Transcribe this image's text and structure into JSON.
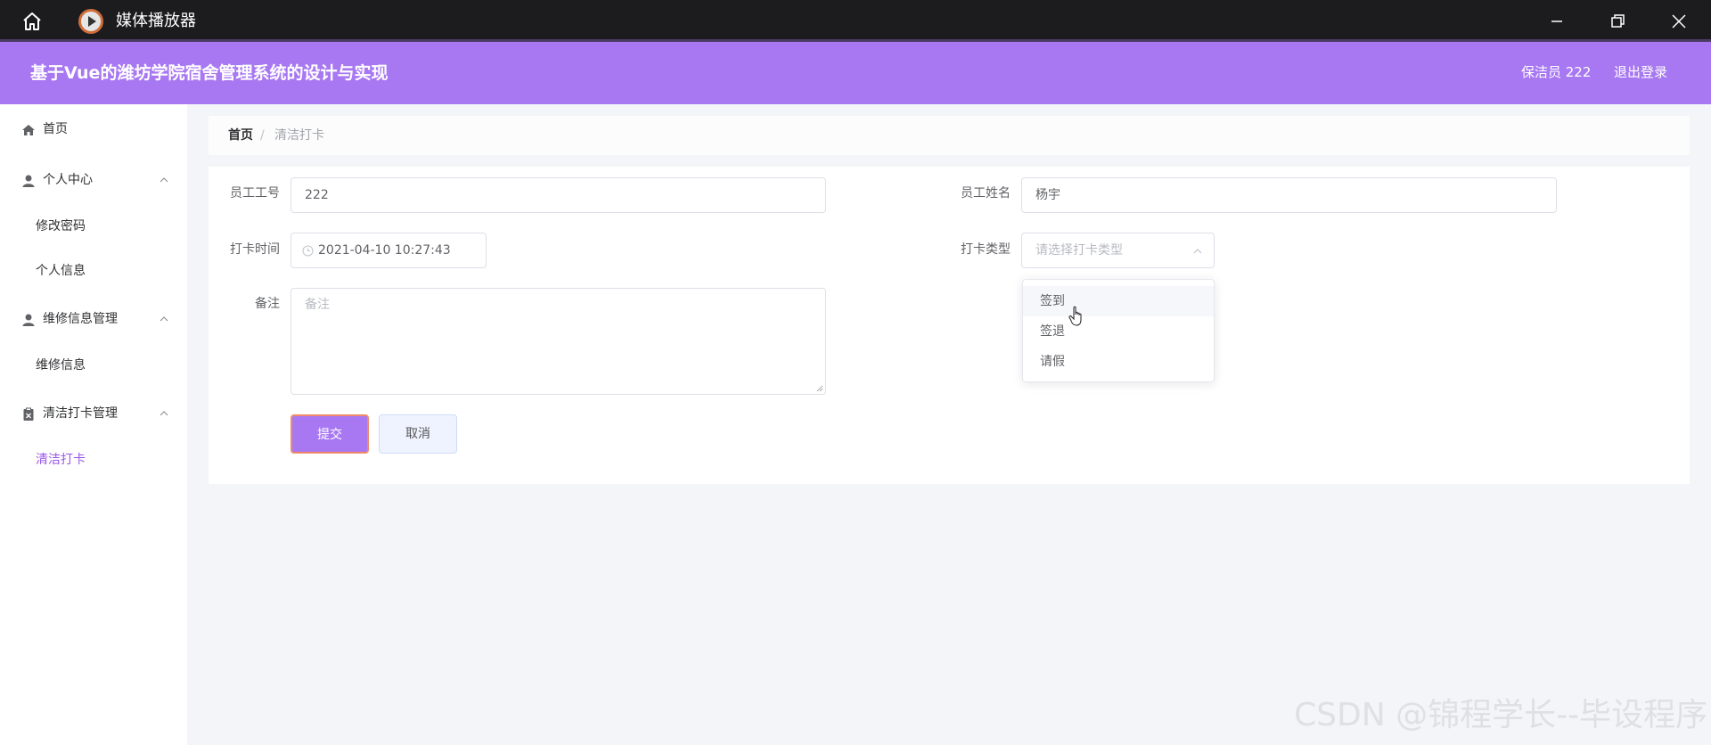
{
  "window": {
    "title": "媒体播放器",
    "icons": [
      "home-icon",
      "media-player-icon",
      "minimize-icon",
      "restore-icon",
      "close-icon"
    ]
  },
  "header": {
    "brand": "基于Vue的潍坊学院宿舍管理系统的设计与实现",
    "user": "保洁员 222",
    "logout": "退出登录",
    "accent_color": "#a878f2"
  },
  "sidebar": {
    "items": [
      {
        "label": "首页",
        "icon": "home-icon"
      },
      {
        "label": "个人中心",
        "icon": "user-icon",
        "expanded": true,
        "children": [
          "修改密码",
          "个人信息"
        ]
      },
      {
        "label": "维修信息管理",
        "icon": "user-icon",
        "expanded": true,
        "children": [
          "维修信息"
        ]
      },
      {
        "label": "清洁打卡管理",
        "icon": "clipboard-icon",
        "expanded": true,
        "children": [
          "清洁打卡"
        ]
      }
    ],
    "active_item": "清洁打卡",
    "active_color": "#9a57e8"
  },
  "breadcrumb": {
    "home": "首页",
    "separator": "/",
    "current": "清洁打卡"
  },
  "form": {
    "employee_id_label": "员工工号",
    "employee_id_value": "222",
    "employee_name_label": "员工姓名",
    "employee_name_value": "杨宇",
    "time_label": "打卡时间",
    "time_value": "2021-04-10 10:27:43",
    "type_label": "打卡类型",
    "type_placeholder": "请选择打卡类型",
    "remark_label": "备注",
    "remark_placeholder": "备注",
    "submit": "提交",
    "cancel": "取消"
  },
  "dropdown": {
    "options": [
      "签到",
      "签退",
      "请假"
    ],
    "hovered": "签到"
  },
  "watermark": "CSDN @锦程学长--毕设程序"
}
